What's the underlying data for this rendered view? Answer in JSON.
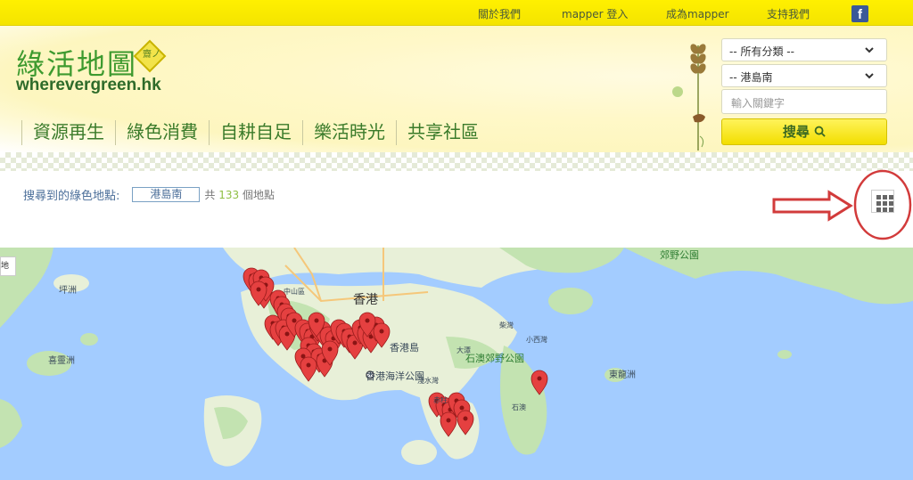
{
  "topbar": {
    "links": [
      "關於我們",
      "mapper 登入",
      "成為mapper",
      "支持我們"
    ],
    "facebook_icon": "f"
  },
  "brand": {
    "name_zh": "綠活地圖",
    "domain": "wherevergreen.hk",
    "badge_text": "齋ノ"
  },
  "nav": [
    "資源再生",
    "綠色消費",
    "自耕自足",
    "樂活時光",
    "共享社區"
  ],
  "search": {
    "category_select": "-- 所有分類 --",
    "region_select": "-- 港島南",
    "keyword_placeholder": "輸入關鍵字",
    "button_label": "搜尋"
  },
  "results": {
    "label": "搜尋到的綠色地點:",
    "region": "港島南",
    "prefix": "共",
    "count": "133",
    "suffix": "個地點"
  },
  "map": {
    "control_label": "地圖",
    "labels": {
      "hk": "香港",
      "hk_island": "香港島",
      "ocean_park": "香港海洋公園",
      "shek_o_park": "石澳郊野公園",
      "peng_chau": "坪洲",
      "hei_ling_chau": "喜靈洲",
      "tung_lung": "東龍洲",
      "country_park": "郊野公園"
    },
    "small_labels": [
      "中山區",
      "大潭",
      "赤柱",
      "石澳",
      "小西灣",
      "柴灣",
      "淺水灣"
    ],
    "colors": {
      "water": "#a3ccff",
      "land": "#e8f0d8",
      "park": "#c3e3b1",
      "pin": "#e54040"
    }
  }
}
